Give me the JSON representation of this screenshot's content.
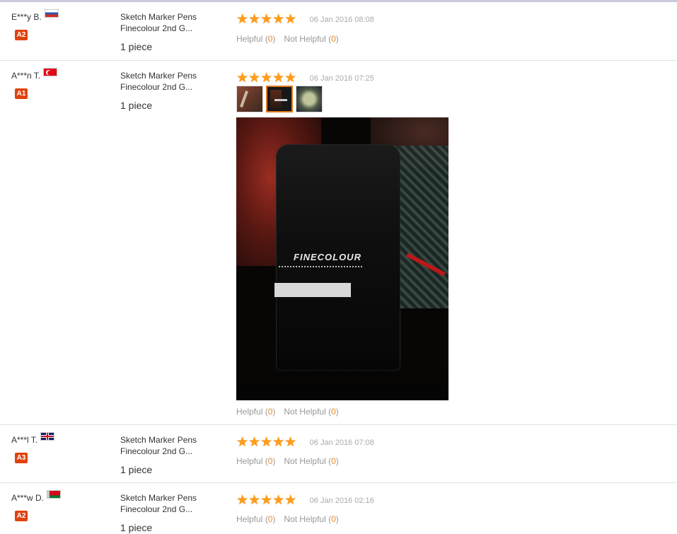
{
  "reviews": [
    {
      "buyer": "E***y B.",
      "flag": "ru",
      "level": "A2",
      "product": "Sketch Marker Pens Finecolour 2nd G...",
      "quantity": "1 piece",
      "stars": "★★★★★",
      "rating": 5,
      "date": "06 Jan 2016 08:08",
      "helpful_label": "Helpful",
      "helpful_count": "0",
      "not_helpful_label": "Not Helpful",
      "not_helpful_count": "0"
    },
    {
      "buyer": "A***n T.",
      "flag": "tr",
      "level": "A1",
      "product": "Sketch Marker Pens Finecolour 2nd G...",
      "quantity": "1 piece",
      "stars": "★★★★★",
      "rating": 5,
      "date": "06 Jan 2016 07:25",
      "photo_brand": "FINECOLOUR",
      "helpful_label": "Helpful",
      "helpful_count": "0",
      "not_helpful_label": "Not Helpful",
      "not_helpful_count": "0"
    },
    {
      "buyer": "A***l T.",
      "flag": "gb",
      "level": "A3",
      "product": "Sketch Marker Pens Finecolour 2nd G...",
      "quantity": "1 piece",
      "stars": "★★★★★",
      "rating": 5,
      "date": "06 Jan 2016 07:08",
      "helpful_label": "Helpful",
      "helpful_count": "0",
      "not_helpful_label": "Not Helpful",
      "not_helpful_count": "0"
    },
    {
      "buyer": "A***w D.",
      "flag": "by",
      "level": "A2",
      "product": "Sketch Marker Pens Finecolour 2nd G...",
      "quantity": "1 piece",
      "stars": "★★★★★",
      "rating": 5,
      "date": "06 Jan 2016 02:16",
      "helpful_label": "Helpful",
      "helpful_count": "0",
      "not_helpful_label": "Not Helpful",
      "not_helpful_count": "0"
    }
  ],
  "colors": {
    "star": "#ff9c1a",
    "level_badge": "#e0420e",
    "count": "#e58a2f",
    "muted": "#999999"
  }
}
